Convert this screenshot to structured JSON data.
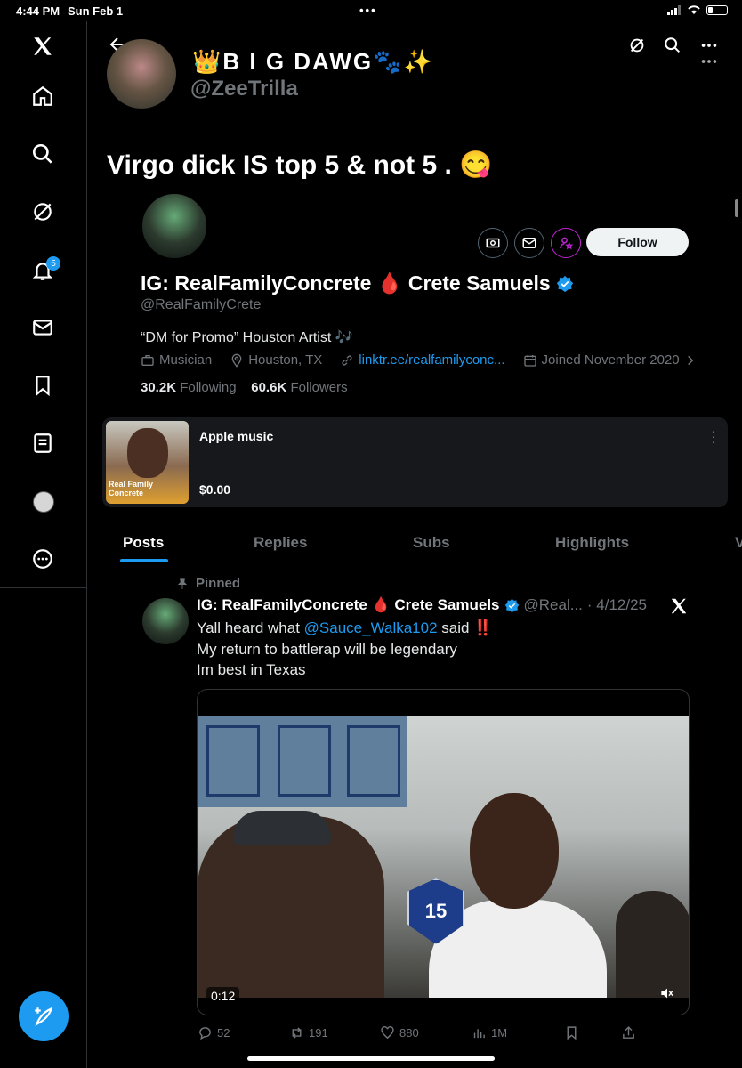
{
  "status_bar": {
    "time": "4:44 PM",
    "date": "Sun Feb 1"
  },
  "rail": {
    "notification_count": "5"
  },
  "quoted": {
    "name": "👑B I G DAWG🐾✨",
    "handle": "@ZeeTrilla",
    "text": "Virgo dick IS top 5 & not 5 . 😋"
  },
  "profile": {
    "name": "IG: RealFamilyConcrete 🩸 Crete Samuels",
    "handle": "@RealFamilyCrete",
    "bio": "“DM for Promo” Houston Artist 🎶",
    "category": "Musician",
    "location": "Houston, TX",
    "link": "linktr.ee/realfamilyconc...",
    "joined": "Joined November 2020",
    "following_count": "30.2K",
    "following_label": "Following",
    "followers_count": "60.6K",
    "followers_label": "Followers",
    "follow_label": "Follow"
  },
  "shop_card": {
    "title": "Apple music",
    "price": "$0.00",
    "thumb_caption": "Real Family Concrete"
  },
  "tabs": [
    "Posts",
    "Replies",
    "Subs",
    "Highlights",
    "V"
  ],
  "post": {
    "pinned_label": "Pinned",
    "name": "IG: RealFamilyConcrete 🩸 Crete Samuels",
    "handle": "@Real...",
    "date": "· 4/12/25",
    "line1_pre": "Yall heard what ",
    "line1_mention": "@Sauce_Walka102",
    "line1_post": " said",
    "line1_bang": "‼️",
    "line2": "My return to battlerap will be legendary",
    "line3": "Im best in Texas",
    "video_time": "0:12",
    "video_logo": "15",
    "replies": "52",
    "reposts": "191",
    "likes": "880",
    "views": "1M"
  },
  "colors": {
    "accent": "#1d9bf0",
    "background": "#000000",
    "muted": "#71767b"
  }
}
